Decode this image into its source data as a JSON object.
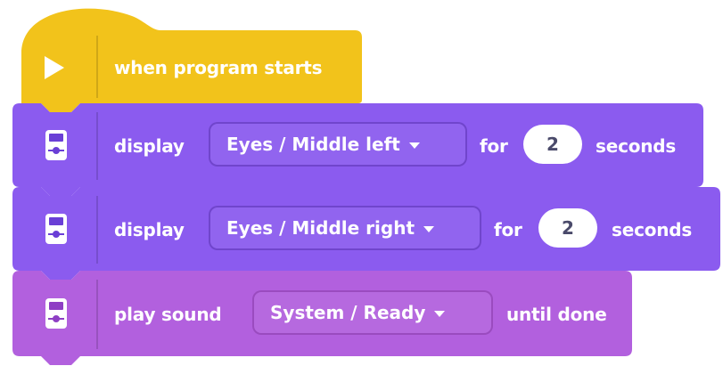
{
  "colors": {
    "event_block": "#F2C31B",
    "display_block": "#8B5BEF",
    "sound_block": "#B260DE",
    "number_text": "#4A4A6A"
  },
  "blocks": [
    {
      "type": "event",
      "icon": "play-icon",
      "label": "when program starts"
    },
    {
      "type": "display",
      "icon": "display-hub-icon",
      "verb": "display",
      "dropdown": "Eyes / Middle left",
      "for_label": "for",
      "number": "2",
      "unit": "seconds"
    },
    {
      "type": "display",
      "icon": "display-hub-icon",
      "verb": "display",
      "dropdown": "Eyes / Middle right",
      "for_label": "for",
      "number": "2",
      "unit": "seconds"
    },
    {
      "type": "sound",
      "icon": "sound-hub-icon",
      "verb": "play sound",
      "dropdown": "System / Ready",
      "suffix": "until done"
    }
  ]
}
